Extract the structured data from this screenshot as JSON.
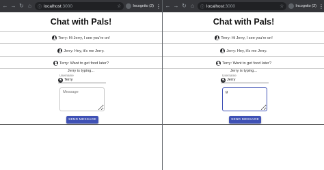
{
  "browser": {
    "url_host": "localhost",
    "url_port": ":3000",
    "incognito_label": "Incognito (2)"
  },
  "app": {
    "title": "Chat with Pals!",
    "messages": [
      "Terry: Hi Jerry, I see you're on!",
      "Jerry: Hey, it's me Jerry.",
      "Terry: Want to get food later?"
    ],
    "typing_indicator": "Jerry is typing...",
    "username_label": "Username",
    "send_label": "SEND MESSAGE"
  },
  "windows": [
    {
      "username": "Terry",
      "message_placeholder": "Message",
      "message_value": ""
    },
    {
      "username": "Jerry",
      "message_placeholder": "Message",
      "message_value": "g"
    }
  ],
  "colors": {
    "accent": "#3f51b5",
    "chrome_bar": "#35363a",
    "omnibox": "#202124"
  },
  "icons": [
    "back-arrow-icon",
    "forward-arrow-icon",
    "reload-icon",
    "home-icon",
    "lock-icon",
    "star-icon",
    "incognito-icon",
    "menu-dots-icon",
    "account-circle-icon"
  ]
}
